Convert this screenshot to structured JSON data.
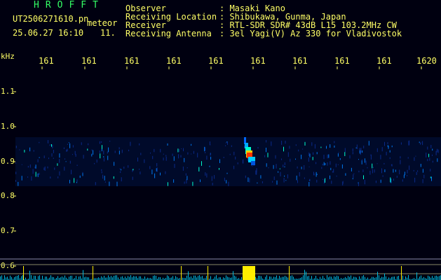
{
  "header": {
    "brand": "HROFFT",
    "filename": "UT2506271610.pn",
    "tag": "meteor",
    "datetime": "25.06.27 16:10",
    "count": "11.",
    "fields": [
      {
        "label": "Observer",
        "value": ": Masaki Kano"
      },
      {
        "label": "Receiving Location",
        "value": ": Shibukawa, Gunma, Japan"
      },
      {
        "label": "Receiver",
        "value": ": RTL-SDR SDR# 43dB L15 103.2MHz CW"
      },
      {
        "label": "Receiving Antenna",
        "value": ": 3el Yagi(V) Az 330 for Vladivostok"
      }
    ]
  },
  "axis": {
    "unit": "kHz",
    "x_ticks": [
      "161",
      "161",
      "161",
      "161",
      "161",
      "161",
      "161",
      "161",
      "161",
      "1620"
    ],
    "y_ticks": [
      "1.1",
      "1.0",
      "0.9",
      "0.8",
      "0.7",
      "0.6"
    ]
  },
  "colors": {
    "background": "#000010",
    "label": "#ffff66",
    "brand": "#33ff66",
    "signal": "#00ccff",
    "meteor_core": "#ff3300",
    "power_bar": "#ffee00"
  }
}
